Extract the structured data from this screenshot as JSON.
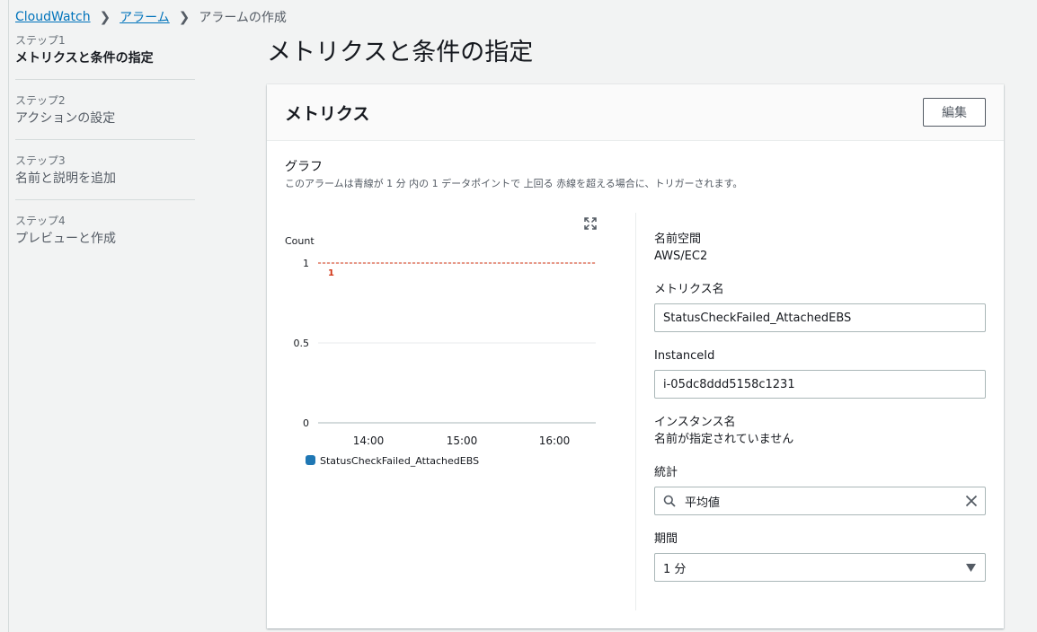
{
  "breadcrumb": {
    "root": "CloudWatch",
    "alarms": "アラーム",
    "current": "アラームの作成"
  },
  "steps": [
    {
      "num": "ステップ1",
      "title": "メトリクスと条件の指定"
    },
    {
      "num": "ステップ2",
      "title": "アクションの設定"
    },
    {
      "num": "ステップ3",
      "title": "名前と説明を追加"
    },
    {
      "num": "ステップ4",
      "title": "プレビューと作成"
    }
  ],
  "page_title": "メトリクスと条件の指定",
  "panel": {
    "title": "メトリクス",
    "edit_label": "編集",
    "graph_label": "グラフ",
    "graph_desc": "このアラームは青線が 1 分 内の 1 データポイントで 上回る 赤線を超える場合に、トリガーされます。"
  },
  "chart_data": {
    "type": "line",
    "ylabel": "Count",
    "y_ticks": [
      "0",
      "0.5",
      "1"
    ],
    "ylim": [
      0,
      1
    ],
    "x_ticks": [
      "14:00",
      "15:00",
      "16:00"
    ],
    "threshold": 1,
    "threshold_label": "1",
    "threshold_color": "#d13212",
    "series": [
      {
        "name": "StatusCheckFailed_AttachedEBS",
        "color": "#1f77b4",
        "values": []
      }
    ]
  },
  "fields": {
    "namespace_label": "名前空間",
    "namespace_value": "AWS/EC2",
    "metric_name_label": "メトリクス名",
    "metric_name_value": "StatusCheckFailed_AttachedEBS",
    "instance_id_label": "InstanceId",
    "instance_id_value": "i-05dc8ddd5158c1231",
    "instance_name_label": "インスタンス名",
    "instance_name_value": "名前が指定されていません",
    "statistic_label": "統計",
    "statistic_value": "平均値",
    "period_label": "期間",
    "period_value": "1 分"
  }
}
